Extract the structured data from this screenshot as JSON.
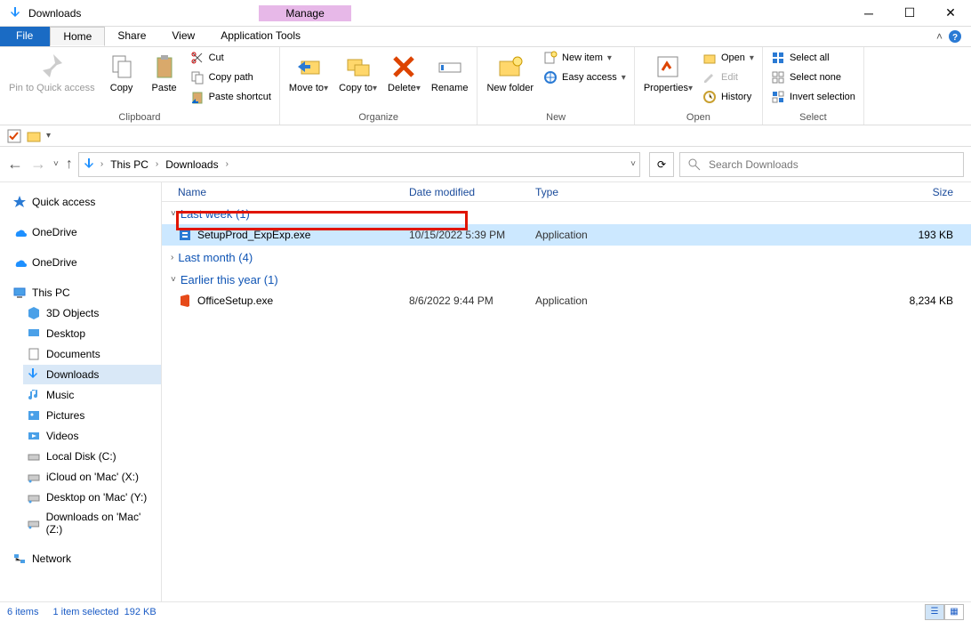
{
  "title": "Downloads",
  "contextual_tab": "Manage",
  "tabs": {
    "file": "File",
    "home": "Home",
    "share": "Share",
    "view": "View",
    "apptools": "Application Tools"
  },
  "ribbon": {
    "clipboard": {
      "label": "Clipboard",
      "pin": "Pin to Quick access",
      "copy": "Copy",
      "paste": "Paste",
      "cut": "Cut",
      "copy_path": "Copy path",
      "paste_shortcut": "Paste shortcut"
    },
    "organize": {
      "label": "Organize",
      "move_to": "Move to",
      "copy_to": "Copy to",
      "delete": "Delete",
      "rename": "Rename"
    },
    "new": {
      "label": "New",
      "new_folder": "New folder",
      "new_item": "New item",
      "easy_access": "Easy access"
    },
    "open": {
      "label": "Open",
      "properties": "Properties",
      "open": "Open",
      "edit": "Edit",
      "history": "History"
    },
    "select": {
      "label": "Select",
      "select_all": "Select all",
      "select_none": "Select none",
      "invert": "Invert selection"
    }
  },
  "breadcrumb": {
    "root": "This PC",
    "current": "Downloads"
  },
  "search_placeholder": "Search Downloads",
  "tree": {
    "quick_access": "Quick access",
    "onedrive1": "OneDrive",
    "onedrive2": "OneDrive",
    "this_pc": "This PC",
    "objects3d": "3D Objects",
    "desktop": "Desktop",
    "documents": "Documents",
    "downloads": "Downloads",
    "music": "Music",
    "pictures": "Pictures",
    "videos": "Videos",
    "local_disk": "Local Disk (C:)",
    "icloud": "iCloud on 'Mac' (X:)",
    "desktop_mac": "Desktop on 'Mac' (Y:)",
    "downloads_mac": "Downloads on 'Mac' (Z:)",
    "network": "Network"
  },
  "columns": {
    "name": "Name",
    "date": "Date modified",
    "type": "Type",
    "size": "Size"
  },
  "groups": [
    {
      "label": "Last week (1)"
    },
    {
      "label": "Last month (4)"
    },
    {
      "label": "Earlier this year (1)"
    }
  ],
  "files": {
    "setupprod": {
      "name": "SetupProd_ExpExp.exe",
      "date": "10/15/2022 5:39 PM",
      "type": "Application",
      "size": "193 KB"
    },
    "officesetup": {
      "name": "OfficeSetup.exe",
      "date": "8/6/2022 9:44 PM",
      "type": "Application",
      "size": "8,234 KB"
    }
  },
  "status": {
    "count": "6 items",
    "selected": "1 item selected",
    "size": "192 KB"
  }
}
